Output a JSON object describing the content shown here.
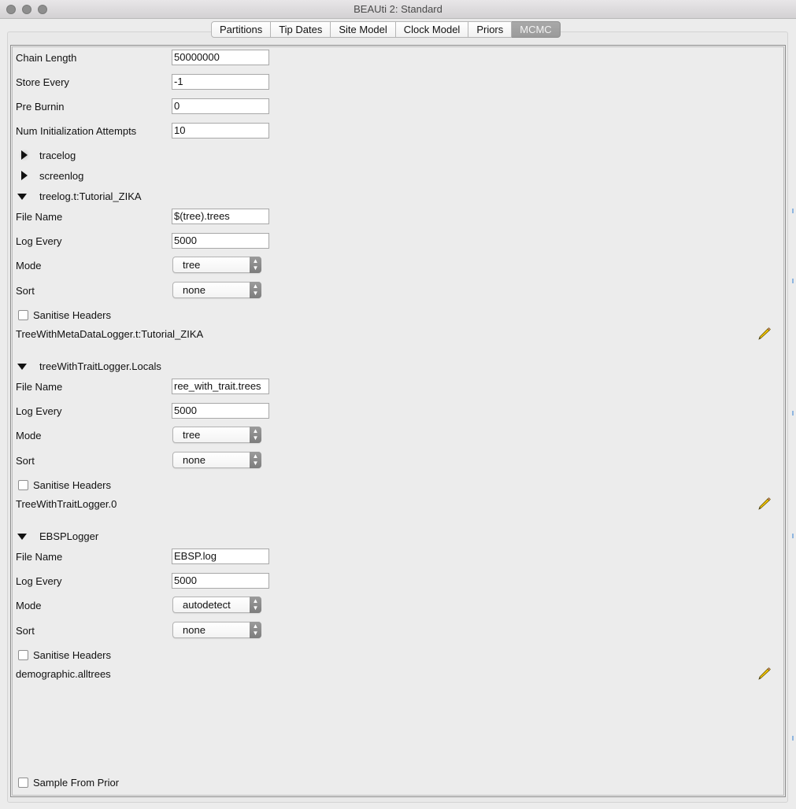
{
  "window": {
    "title": "BEAUti 2: Standard"
  },
  "tabs": [
    {
      "label": "Partitions"
    },
    {
      "label": "Tip Dates"
    },
    {
      "label": "Site Model"
    },
    {
      "label": "Clock Model"
    },
    {
      "label": "Priors"
    },
    {
      "label": "MCMC"
    }
  ],
  "mcmc": {
    "chain_length_label": "Chain Length",
    "chain_length_value": "50000000",
    "store_every_label": "Store Every",
    "store_every_value": "-1",
    "pre_burnin_label": "Pre Burnin",
    "pre_burnin_value": "0",
    "num_init_label": "Num Initialization Attempts",
    "num_init_value": "10"
  },
  "tracelog": {
    "label": "tracelog"
  },
  "screenlog": {
    "label": "screenlog"
  },
  "treelog": {
    "label": "treelog.t:Tutorial_ZIKA",
    "file_name_label": "File Name",
    "file_name_value": "$(tree).trees",
    "log_every_label": "Log Every",
    "log_every_value": "5000",
    "mode_label": "Mode",
    "mode_value": "tree",
    "sort_label": "Sort",
    "sort_value": "none",
    "sanitise_label": "Sanitise Headers",
    "logger_label": "TreeWithMetaDataLogger.t:Tutorial_ZIKA"
  },
  "trait_logger": {
    "label": "treeWithTraitLogger.Locals",
    "file_name_label": "File Name",
    "file_name_value": "ree_with_trait.trees",
    "log_every_label": "Log Every",
    "log_every_value": "5000",
    "mode_label": "Mode",
    "mode_value": "tree",
    "sort_label": "Sort",
    "sort_value": "none",
    "sanitise_label": "Sanitise Headers",
    "logger_label": "TreeWithTraitLogger.0"
  },
  "ebsp_logger": {
    "label": "EBSPLogger",
    "file_name_label": "File Name",
    "file_name_value": "EBSP.log",
    "log_every_label": "Log Every",
    "log_every_value": "5000",
    "mode_label": "Mode",
    "mode_value": "autodetect",
    "sort_label": "Sort",
    "sort_value": "none",
    "sanitise_label": "Sanitise Headers",
    "logger_label": "demographic.alltrees"
  },
  "sample_from_prior_label": "Sample From Prior",
  "icons": {
    "edit": "pencil-icon",
    "collapsed": "triangle-right-icon",
    "expanded": "triangle-down-icon"
  }
}
